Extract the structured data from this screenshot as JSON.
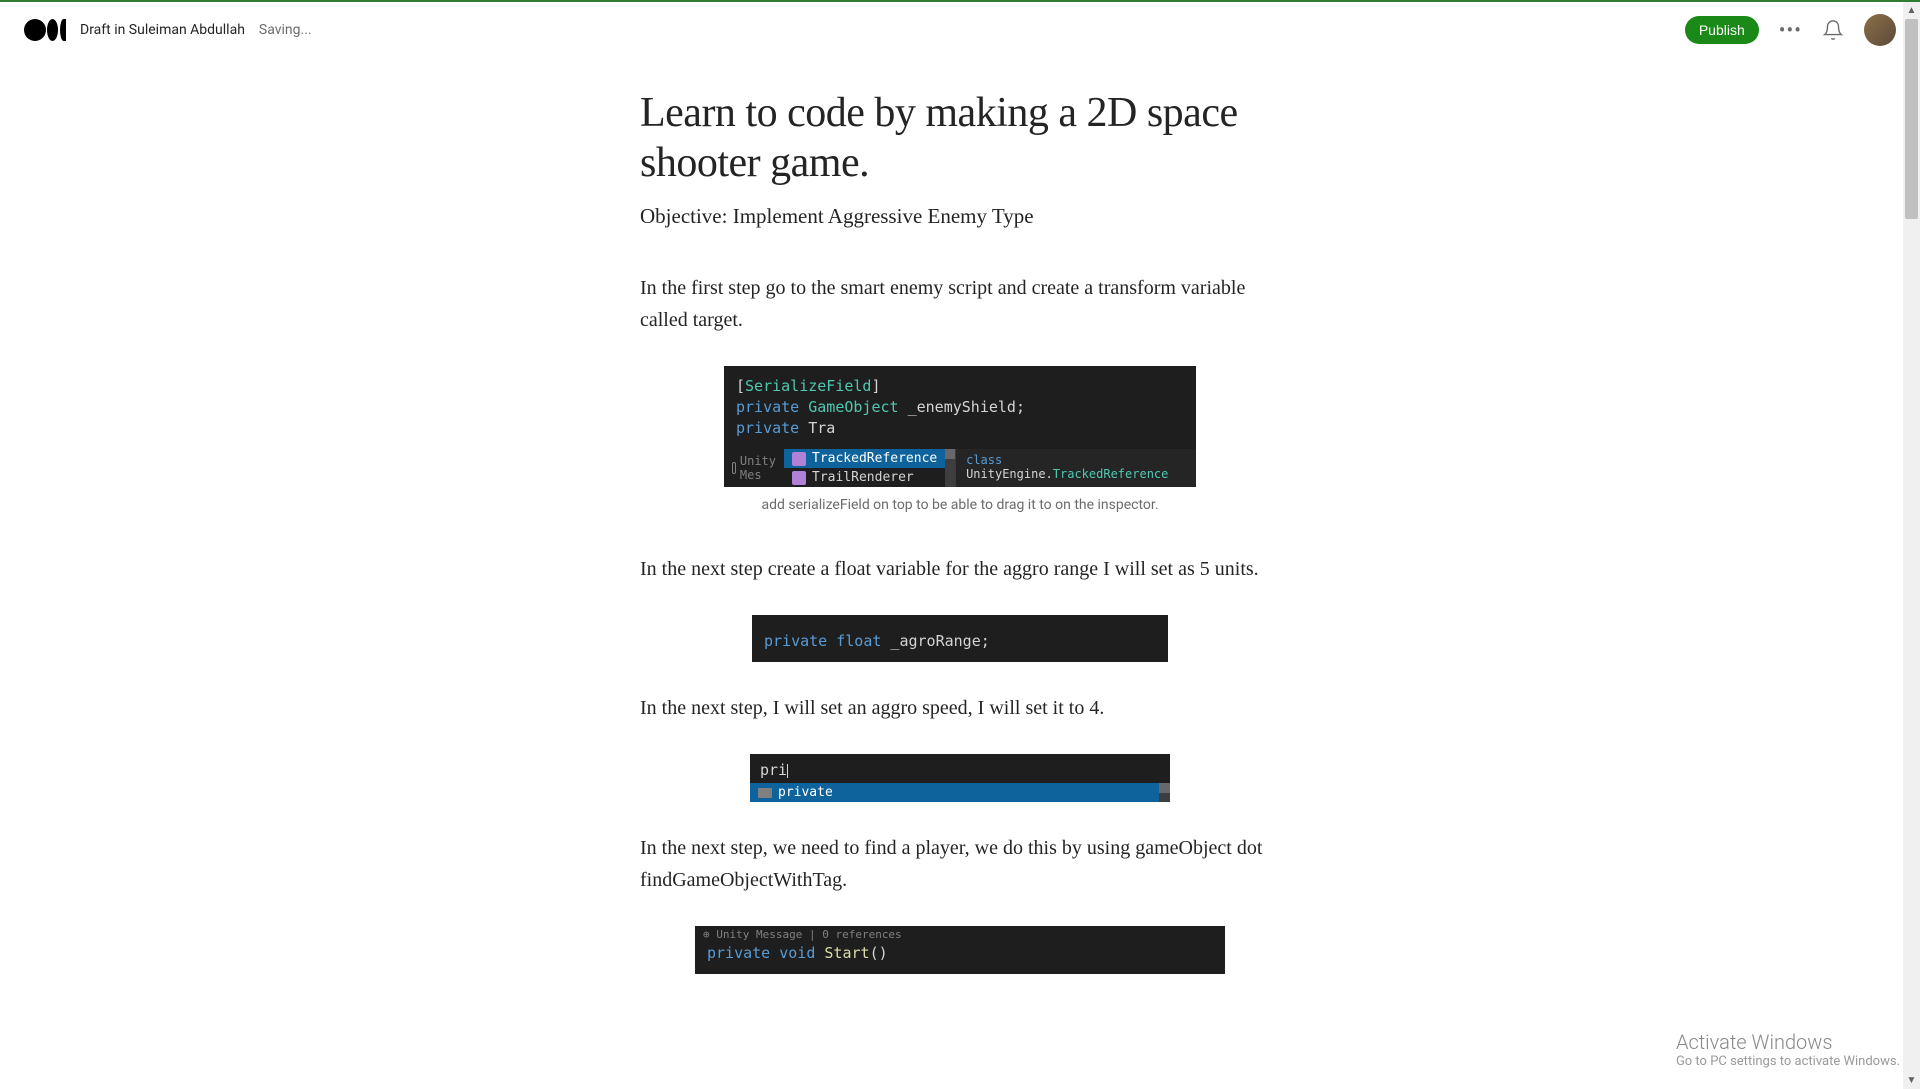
{
  "header": {
    "draft_in": "Draft in Suleiman Abdullah",
    "saving": "Saving...",
    "publish": "Publish"
  },
  "article": {
    "title": "Learn to code by making a 2D space shooter game.",
    "subtitle": "Objective: Implement Aggressive Enemy Type",
    "para1": "In the first step go to the smart enemy script and create a transform variable called target.",
    "caption1": "add serializeField on top to be able to drag it to on the inspector.",
    "para2": "In the next step create a float variable for the aggro range I will set as 5 units.",
    "para3": "In the next step, I will set an aggro speed, I will set it to 4.",
    "para4": "In the next step, we need to find a player, we do this by using gameObject dot findGameObjectWithTag."
  },
  "code1": {
    "attr_open": "[",
    "attr_name": "SerializeField",
    "attr_close": "]",
    "private": "private",
    "gameobject": "GameObject",
    "enemyshield": " _enemyShield;",
    "tra": " Tra",
    "autocomplete1": "TrackedReference",
    "autocomplete2": "TrailRenderer",
    "tooltip_class": "class",
    "tooltip_ns": " UnityEngine.",
    "tooltip_name": "TrackedReference",
    "unity_msg": "Unity Mes"
  },
  "code2": {
    "private": "private",
    "float": " float",
    "varname": " _agroRange;"
  },
  "code3": {
    "pri": "pri",
    "autocomplete": "private"
  },
  "code4": {
    "unity_msg": "Unity Message | 0 references",
    "private": "private",
    "void": " void",
    "start": " Start",
    "parens": "()"
  },
  "activate": {
    "title": "Activate Windows",
    "sub": "Go to PC settings to activate Windows."
  }
}
